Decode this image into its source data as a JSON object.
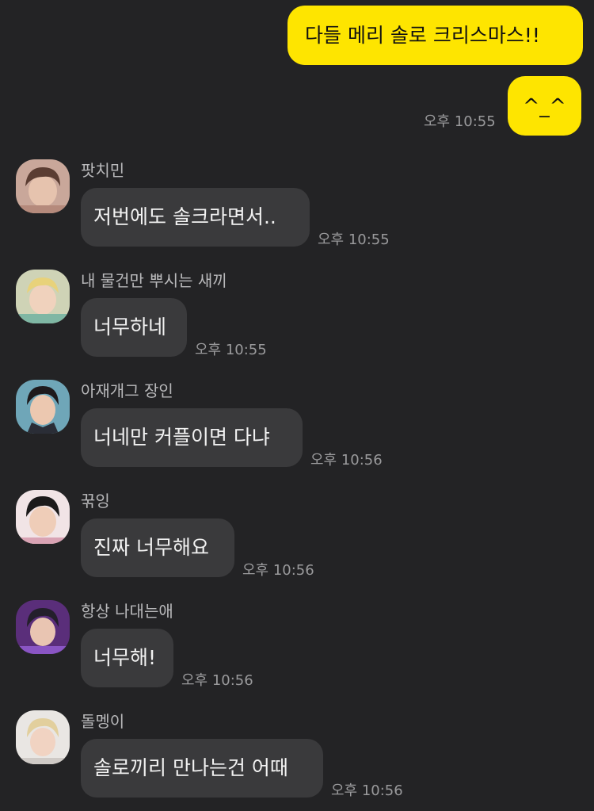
{
  "outgoing": [
    {
      "text": "다들 메리 솔로 크리스마스!!"
    },
    {
      "text": "^_^",
      "time": "오후 10:55"
    }
  ],
  "incoming": [
    {
      "sender": "팟치민",
      "text": "저번에도 솔크라면서..",
      "time": "오후 10:55"
    },
    {
      "sender": "내 물건만 뿌시는 새끼",
      "text": "너무하네",
      "time": "오후 10:55"
    },
    {
      "sender": "아재개그 장인",
      "text": "너네만 커플이면 다냐",
      "time": "오후 10:56"
    },
    {
      "sender": "꾺잉",
      "text": "진짜 너무해요",
      "time": "오후 10:56"
    },
    {
      "sender": "항상 나대는애",
      "text": "너무해!",
      "time": "오후 10:56"
    },
    {
      "sender": "돌멩이",
      "text": "솔로끼리 만나는건 어때",
      "time": "오후 10:56"
    }
  ],
  "colors": {
    "background": "#232325",
    "outgoing_bubble": "#FEE500",
    "incoming_bubble": "#3A3A3C",
    "timestamp": "#9A9A9C"
  },
  "icons": {
    "avatars": [
      "profile-photo-icon",
      "profile-photo-icon",
      "profile-photo-icon",
      "profile-photo-icon",
      "profile-photo-icon",
      "profile-photo-icon"
    ]
  }
}
